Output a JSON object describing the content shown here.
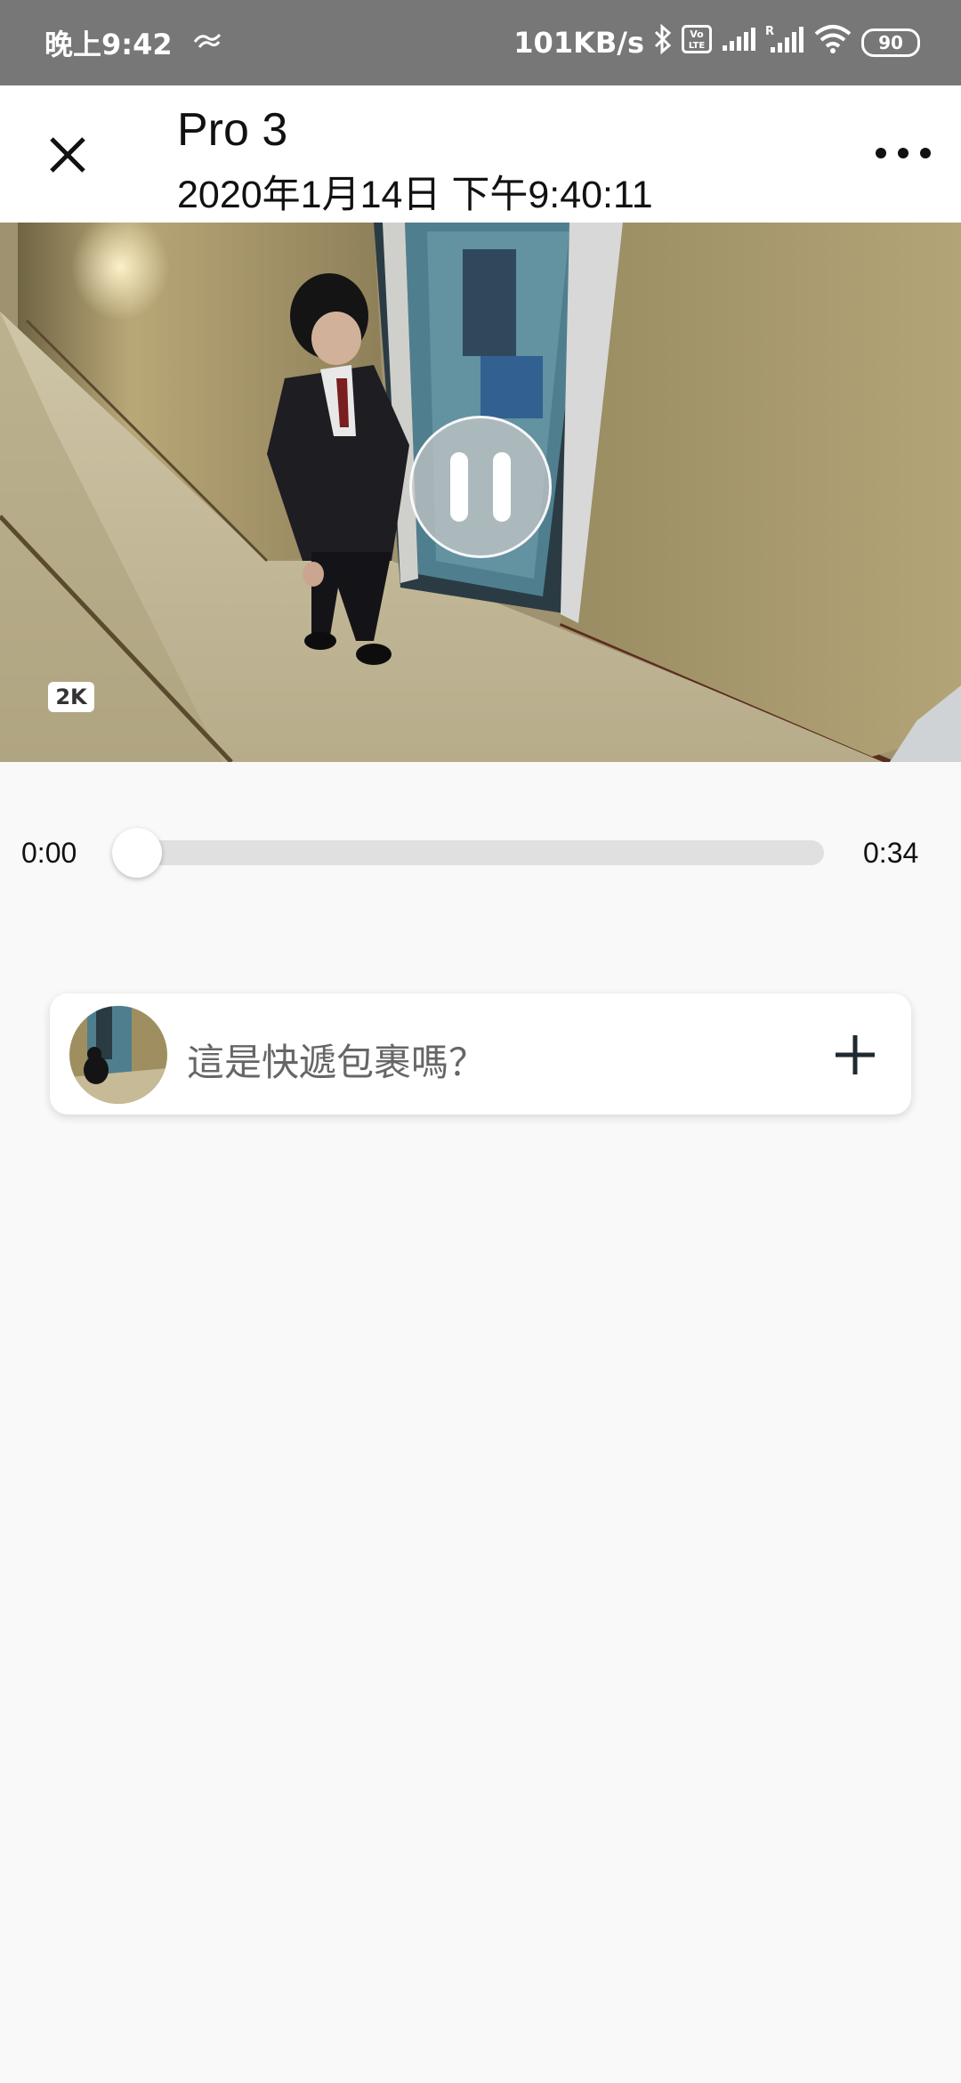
{
  "status_bar": {
    "time": "晚上9:42",
    "network_speed": "101KB/s",
    "volte_label": "Vo LTE",
    "roaming_label": "R",
    "battery_level": "90"
  },
  "header": {
    "title": "Pro 3",
    "subtitle": "2020年1月14日 下午9:40:11"
  },
  "video": {
    "quality_badge": "2K"
  },
  "playback": {
    "current_time": "0:00",
    "duration": "0:34",
    "progress": 0.0
  },
  "suggestion_card": {
    "question": "這是快遞包裹嗎？"
  },
  "colors": {
    "status_bar_bg": "#777777",
    "header_bg": "#ffffff",
    "page_bg": "#f9f9f9",
    "track": "#e0e0e0"
  }
}
